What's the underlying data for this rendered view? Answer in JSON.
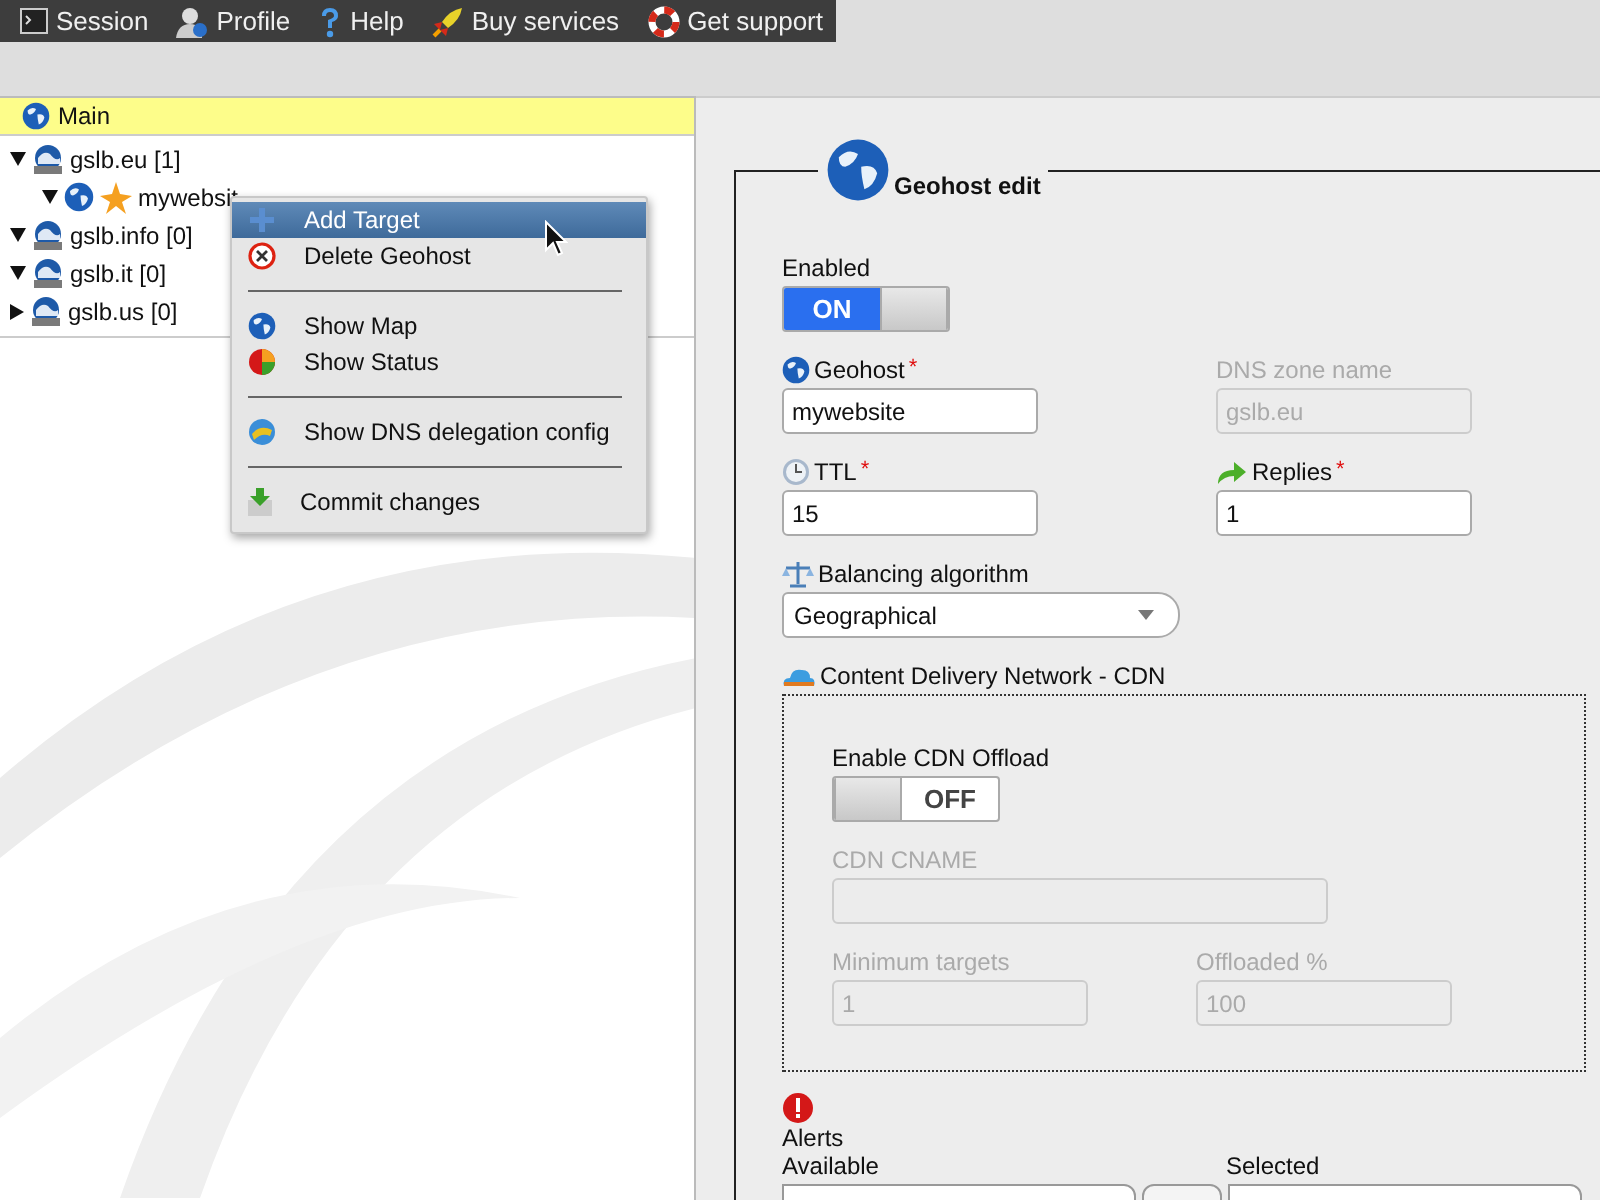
{
  "toolbar": [
    {
      "label": "Session"
    },
    {
      "label": "Profile"
    },
    {
      "label": "Help"
    },
    {
      "label": "Buy services"
    },
    {
      "label": "Get support"
    }
  ],
  "tree": {
    "title": "Main",
    "items": [
      {
        "label": "gslb.eu [1]",
        "expanded": true,
        "children": [
          {
            "label": "mywebsit",
            "expanded": true
          }
        ]
      },
      {
        "label": "gslb.info [0]",
        "expanded": true
      },
      {
        "label": "gslb.it [0]",
        "expanded": true
      },
      {
        "label": "gslb.us [0]",
        "expanded": false
      }
    ]
  },
  "context_menu": {
    "groups": [
      [
        {
          "label": "Add Target",
          "selected": true
        },
        {
          "label": "Delete Geohost",
          "selected": false
        }
      ],
      [
        {
          "label": "Show Map",
          "selected": false
        },
        {
          "label": "Show Status",
          "selected": false
        }
      ],
      [
        {
          "label": "Show DNS delegation config",
          "selected": false
        }
      ],
      [
        {
          "label": "Commit changes",
          "selected": false
        }
      ]
    ]
  },
  "form": {
    "title": "Geohost edit",
    "enabled": {
      "label": "Enabled",
      "on": true,
      "text": "ON"
    },
    "geohost": {
      "label": "Geohost",
      "mark": "*",
      "value": "mywebsite",
      "disabled": false
    },
    "dns_zone": {
      "label": "DNS zone name",
      "value": "gslb.eu",
      "disabled": true
    },
    "ttl": {
      "label": "TTL",
      "mark": "*",
      "value": "15",
      "disabled": false
    },
    "replies": {
      "label": "Replies",
      "mark": "*",
      "value": "1",
      "disabled": false
    },
    "balancing": {
      "label": "Balancing algorithm",
      "value": "Geographical"
    },
    "cdn": {
      "title": "Content Delivery Network - CDN",
      "offload": {
        "label": "Enable CDN Offload",
        "on": false,
        "text": "OFF"
      },
      "cname": {
        "label": "CDN CNAME",
        "disabled": true
      },
      "min_targets": {
        "label": "Minimum targets",
        "value": "1",
        "disabled": true
      },
      "offloaded": {
        "label": "Offloaded %",
        "value": "100",
        "disabled": true
      }
    },
    "alerts": {
      "label": "Alerts",
      "available_label": "Available",
      "selected_label": "Selected"
    }
  }
}
